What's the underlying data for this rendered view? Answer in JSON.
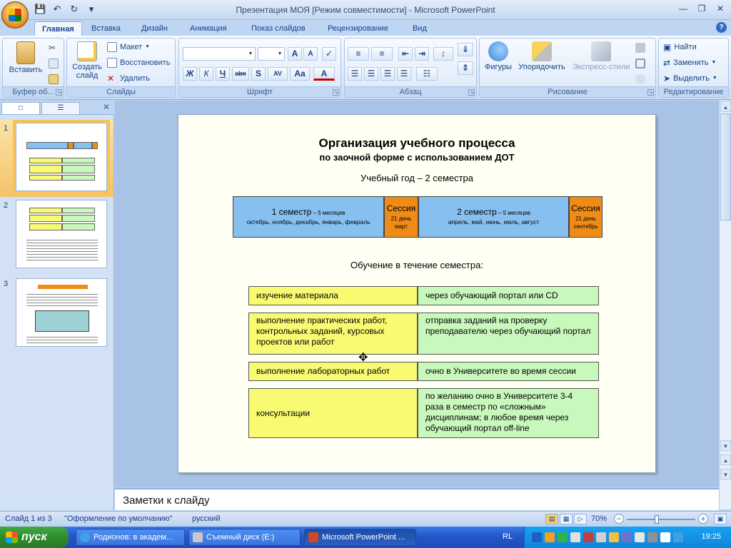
{
  "window": {
    "title": "Презентация МОЯ [Режим совместимости] - Microsoft PowerPoint"
  },
  "tabs": [
    "Главная",
    "Вставка",
    "Дизайн",
    "Анимация",
    "Показ слайдов",
    "Рецензирование",
    "Вид"
  ],
  "ribbon": {
    "clipboard": {
      "label": "Буфер об...",
      "paste": "Вставить"
    },
    "slides": {
      "label": "Слайды",
      "new_slide_1": "Создать",
      "new_slide_2": "слайд",
      "layout": "Макет",
      "reset": "Восстановить",
      "delete": "Удалить"
    },
    "font": {
      "label": "Шрифт",
      "bold": "Ж",
      "italic": "К",
      "underline": "Ч",
      "strike": "abc",
      "shadow": "S",
      "spacing": "AV",
      "case": "Aa",
      "color": "A",
      "grow": "A",
      "shrink": "A"
    },
    "paragraph": {
      "label": "Абзац"
    },
    "drawing": {
      "label": "Рисование",
      "shapes": "Фигуры",
      "arrange": "Упорядочить",
      "quick_styles": "Экспресс-стили"
    },
    "editing": {
      "label": "Редактирование",
      "find": "Найти",
      "replace": "Заменить",
      "select": "Выделить"
    }
  },
  "thumbnails": {
    "numbers": [
      "1",
      "2",
      "3"
    ],
    "selected_index": 1
  },
  "slide": {
    "title": "Организация учебного процесса",
    "subtitle": "по заочной форме с использованием ДОТ",
    "year_label": "Учебный год – 2 семестра",
    "sem1_title": "1 семестр",
    "sem1_dur": " – 5 месяцев",
    "sem1_months": "октябрь, ноябрь, декабрь, январь, февраль",
    "session1_title": "Сессия",
    "session1_days": "21 день",
    "session1_month": "март",
    "sem2_title": "2 семестр",
    "sem2_dur": " – 5 месяцев",
    "sem2_months": "апрель, май, июнь, июль, август",
    "session2_title": "Сессия",
    "session2_days": "21 день",
    "session2_month": "сентябрь",
    "training_label": "Обучение в течение семестра:",
    "rows": [
      {
        "left": "изучение материала",
        "right": "через обучающий портал или CD"
      },
      {
        "left": "выполнение практических работ, контрольных заданий, курсовых проектов или работ",
        "right": "отправка заданий на проверку преподавателю через обучающий портал"
      },
      {
        "left": "выполнение лабораторных работ",
        "right": "очно в Университете во время сессии"
      },
      {
        "left": "консультации",
        "right": "по желанию очно в Университете 3-4 раза в семестр по «сложным» дисциплинам; в любое время через обучающий портал off-line"
      }
    ]
  },
  "notes": {
    "placeholder": "Заметки к слайду"
  },
  "status": {
    "slide_info": "Слайд 1 из 3",
    "theme": "\"Оформление по умолчанию\"",
    "language": "русский",
    "zoom": "70%",
    "zoom_fraction": 0.44
  },
  "taskbar": {
    "start": "пуск",
    "tasks": [
      "Родионов: в академ...",
      "Съемный диск (E:)",
      "Microsoft PowerPoint ..."
    ],
    "lang": "RL",
    "clock": "19:25"
  },
  "colors": {
    "blue": "#87bff1",
    "orange": "#ef8c18",
    "yellow": "#f8fb72",
    "green": "#c9f8bc"
  }
}
